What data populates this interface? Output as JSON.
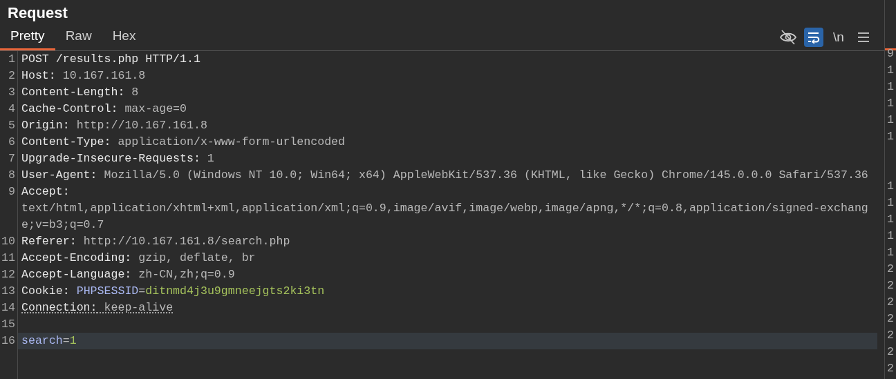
{
  "panel": {
    "title": "Request"
  },
  "tabs": [
    {
      "label": "Pretty",
      "selected": true
    },
    {
      "label": "Raw",
      "selected": false
    },
    {
      "label": "Hex",
      "selected": false
    }
  ],
  "toolbar": [
    {
      "kind": "eye",
      "selected": false
    },
    {
      "kind": "wrap",
      "selected": true
    },
    {
      "kind": "text",
      "label": "\\n",
      "selected": false
    },
    {
      "kind": "menu",
      "selected": false
    }
  ],
  "lines": [
    {
      "number": "1",
      "highlighted": false,
      "underlined": false,
      "parts": [
        {
          "kind": "name",
          "text": "POST /results.php HTTP/1.1"
        }
      ]
    },
    {
      "number": "2",
      "highlighted": false,
      "underlined": false,
      "parts": [
        {
          "kind": "name",
          "text": "Host:"
        },
        {
          "kind": "value",
          "text": " 10.167.161.8"
        }
      ]
    },
    {
      "number": "3",
      "highlighted": false,
      "underlined": false,
      "parts": [
        {
          "kind": "name",
          "text": "Content-Length:"
        },
        {
          "kind": "value",
          "text": " 8"
        }
      ]
    },
    {
      "number": "4",
      "highlighted": false,
      "underlined": false,
      "parts": [
        {
          "kind": "name",
          "text": "Cache-Control:"
        },
        {
          "kind": "value",
          "text": " max-age=0"
        }
      ]
    },
    {
      "number": "5",
      "highlighted": false,
      "underlined": false,
      "parts": [
        {
          "kind": "name",
          "text": "Origin:"
        },
        {
          "kind": "value",
          "text": " http://10.167.161.8"
        }
      ]
    },
    {
      "number": "6",
      "highlighted": false,
      "underlined": false,
      "parts": [
        {
          "kind": "name",
          "text": "Content-Type:"
        },
        {
          "kind": "value",
          "text": " application/x-www-form-urlencoded"
        }
      ]
    },
    {
      "number": "7",
      "highlighted": false,
      "underlined": false,
      "parts": [
        {
          "kind": "name",
          "text": "Upgrade-Insecure-Requests:"
        },
        {
          "kind": "value",
          "text": " 1"
        }
      ]
    },
    {
      "number": "8",
      "highlighted": false,
      "underlined": false,
      "parts": [
        {
          "kind": "name",
          "text": "User-Agent:"
        },
        {
          "kind": "value",
          "text": " Mozilla/5.0 (Windows NT 10.0; Win64; x64) AppleWebKit/537.36 (KHTML, like Gecko) Chrome/145.0.0.0 Safari/537.36"
        }
      ]
    },
    {
      "number": "9",
      "highlighted": false,
      "underlined": false,
      "parts": [
        {
          "kind": "name",
          "text": "Accept:"
        },
        {
          "kind": "block_value",
          "text": "text/html,application/xhtml+xml,application/xml;q=0.9,image/avif,image/webp,image/apng,*/*;q=0.8,application/signed-exchange;v=b3;q=0.7"
        }
      ]
    },
    {
      "number": "10",
      "highlighted": false,
      "underlined": false,
      "parts": [
        {
          "kind": "name",
          "text": "Referer:"
        },
        {
          "kind": "value",
          "text": " http://10.167.161.8/search.php"
        }
      ]
    },
    {
      "number": "11",
      "highlighted": false,
      "underlined": false,
      "parts": [
        {
          "kind": "name",
          "text": "Accept-Encoding:"
        },
        {
          "kind": "value",
          "text": " gzip, deflate, br"
        }
      ]
    },
    {
      "number": "12",
      "highlighted": false,
      "underlined": false,
      "parts": [
        {
          "kind": "name",
          "text": "Accept-Language:"
        },
        {
          "kind": "value",
          "text": " zh-CN,zh;q=0.9"
        }
      ]
    },
    {
      "number": "13",
      "highlighted": false,
      "underlined": false,
      "parts": [
        {
          "kind": "name",
          "text": "Cookie: "
        },
        {
          "kind": "param_name",
          "text": "PHPSESSID"
        },
        {
          "kind": "value",
          "text": "="
        },
        {
          "kind": "param_value",
          "text": "ditnmd4j3u9gmneejgts2ki3tn"
        }
      ]
    },
    {
      "number": "14",
      "highlighted": false,
      "underlined": true,
      "parts": [
        {
          "kind": "name",
          "text": "Connection:"
        },
        {
          "kind": "value",
          "text": " keep-alive"
        }
      ]
    },
    {
      "number": "15",
      "highlighted": false
    },
    {
      "number": "16",
      "highlighted": true,
      "underlined": false,
      "parts": [
        {
          "kind": "param_name",
          "text": "search"
        },
        {
          "kind": "value",
          "text": "="
        },
        {
          "kind": "param_value",
          "text": "1"
        }
      ]
    }
  ],
  "side_panel": {
    "groups": [
      {
        "numbers": [
          "9",
          "1",
          "1",
          "1",
          "1",
          "1"
        ]
      },
      {
        "numbers": [
          "1",
          "1",
          "1",
          "1",
          "1",
          "2",
          "2",
          "2",
          "2",
          "2",
          "2",
          "2"
        ]
      }
    ]
  }
}
